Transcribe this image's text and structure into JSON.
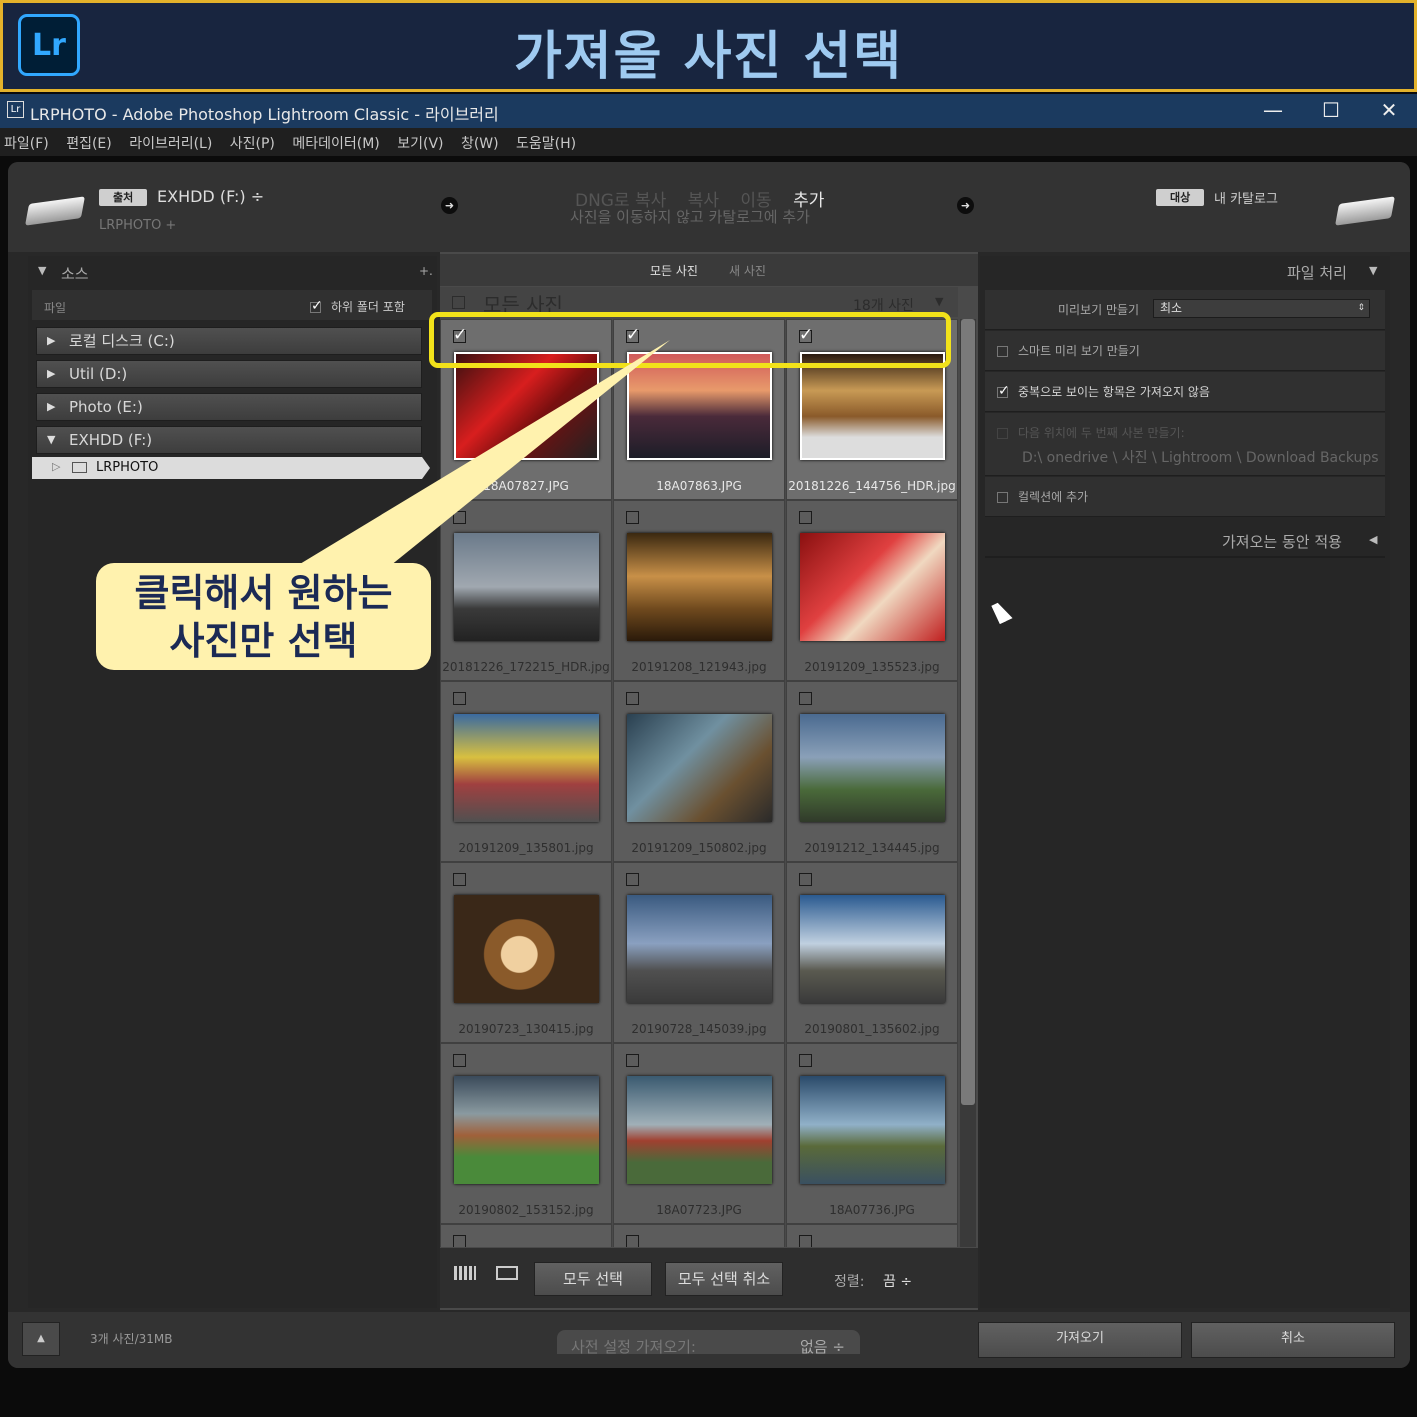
{
  "banner": {
    "logo": "Lr",
    "title": "가져올 사진 선택"
  },
  "titlebar": {
    "icon": "Lr",
    "title": "LRPHOTO - Adobe Photoshop Lightroom Classic - 라이브러리",
    "minimize": "—",
    "maximize": "☐",
    "close": "✕"
  },
  "menu": [
    "파일(F)",
    "편집(E)",
    "라이브러리(L)",
    "사진(P)",
    "메타데이터(M)",
    "보기(V)",
    "창(W)",
    "도움말(H)"
  ],
  "header": {
    "source_tag": "출처",
    "source_drive": "EXHDD (F:) ÷",
    "source_path": "LRPHOTO +",
    "modes": [
      "DNG로 복사",
      "복사",
      "이동",
      "추가"
    ],
    "active_mode": "추가",
    "mode_desc": "사진을 이동하지 않고 카탈로그에 추가",
    "dest_tag": "대상",
    "dest_name": "내 카탈로그"
  },
  "source_panel": {
    "title": "소스",
    "plus": "+.",
    "files_label": "파일",
    "subfolders_label": "하위 폴더 포함",
    "drives": [
      "로컬 디스크 (C:)",
      "Util (D:)",
      "Photo (E:)",
      "EXHDD (F:)"
    ],
    "folder": "LRPHOTO"
  },
  "grid": {
    "tabs": [
      "모든 사진",
      "새 사진"
    ],
    "header_title": "모든 사진",
    "count": "18개 사진",
    "photos": [
      {
        "name": "18A07827.JPG",
        "checked": true
      },
      {
        "name": "18A07863.JPG",
        "checked": true
      },
      {
        "name": "20181226_144756_HDR.jpg",
        "checked": true
      },
      {
        "name": "20181226_172215_HDR.jpg",
        "checked": false
      },
      {
        "name": "20191208_121943.jpg",
        "checked": false
      },
      {
        "name": "20191209_135523.jpg",
        "checked": false
      },
      {
        "name": "20191209_135801.jpg",
        "checked": false
      },
      {
        "name": "20191209_150802.jpg",
        "checked": false
      },
      {
        "name": "20191212_134445.jpg",
        "checked": false
      },
      {
        "name": "20190723_130415.jpg",
        "checked": false
      },
      {
        "name": "20190728_145039.jpg",
        "checked": false
      },
      {
        "name": "20190801_135602.jpg",
        "checked": false
      },
      {
        "name": "20190802_153152.jpg",
        "checked": false
      },
      {
        "name": "18A07723.JPG",
        "checked": false
      },
      {
        "name": "18A07736.JPG",
        "checked": false
      }
    ],
    "select_all": "모두 선택",
    "deselect_all": "모두 선택 취소",
    "sort_label": "정렬:",
    "sort_value": "끔 ÷"
  },
  "file_handling": {
    "title": "파일 처리",
    "preview_label": "미리보기 만들기",
    "preview_value": "최소",
    "smart_preview": "스마트 미리 보기 만들기",
    "no_duplicates": "중복으로 보이는 항목은 가져오지 않음",
    "second_copy": "다음 위치에 두 번째 사본 만들기:",
    "second_copy_path": "D:\\ onedrive \\ 사진 \\ Lightroom \\ Download Backups",
    "add_collection": "컬렉션에 추가",
    "apply_during_import": "가져오는 동안 적용"
  },
  "footer": {
    "summary": "3개 사진/31MB",
    "preset_label": "사전 설정 가져오기:",
    "preset_value": "없음 ÷",
    "import": "가져오기",
    "cancel": "취소"
  },
  "callout": {
    "line1": "클릭해서 원하는",
    "line2": "사진만 선택"
  },
  "colors": {
    "highlight": "#f2e21a",
    "callout_bg": "#fff2ae",
    "banner_border": "#e3b22b",
    "titlebar": "#1b3a5f"
  }
}
